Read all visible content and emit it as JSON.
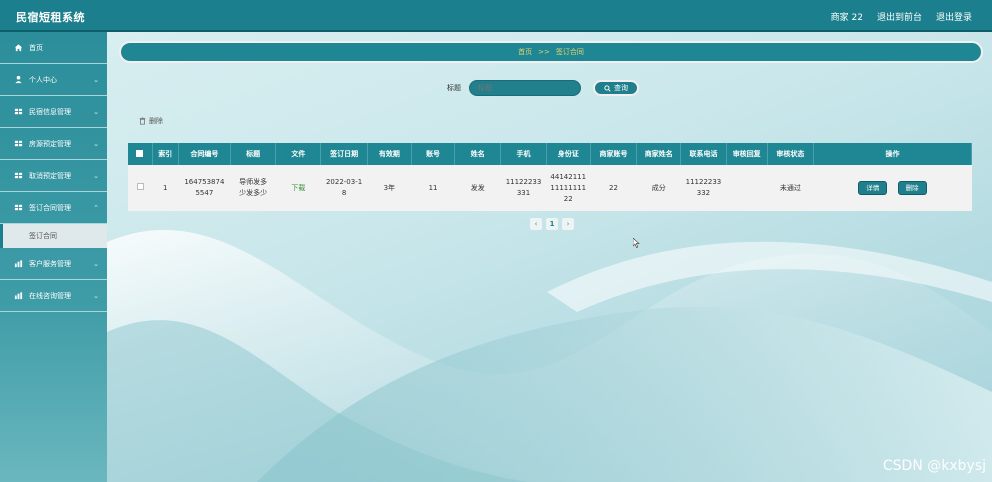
{
  "app": {
    "title": "民宿短租系统",
    "user_label": "商家 22",
    "exit_to_front": "退出到前台",
    "logout": "退出登录"
  },
  "sidebar": {
    "items": [
      {
        "label": "首页",
        "icon": "home-icon",
        "has_arrow": false
      },
      {
        "label": "个人中心",
        "icon": "user-icon",
        "has_arrow": true
      },
      {
        "label": "民宿信息管理",
        "icon": "grid-icon",
        "has_arrow": true
      },
      {
        "label": "房源预定管理",
        "icon": "grid-icon",
        "has_arrow": true
      },
      {
        "label": "取消预定管理",
        "icon": "grid-icon",
        "has_arrow": true
      },
      {
        "label": "签订合同管理",
        "icon": "grid-icon",
        "has_arrow": true
      },
      {
        "label": "客户服务管理",
        "icon": "chart-icon",
        "has_arrow": true
      },
      {
        "label": "在线咨询管理",
        "icon": "chart-icon",
        "has_arrow": true
      }
    ],
    "submenu_label": "签订合同"
  },
  "breadcrumb": {
    "home": "首页",
    "sep": ">>",
    "current": "签订合同"
  },
  "search": {
    "label": "标题",
    "placeholder": "标题",
    "button_label": "查询"
  },
  "toolbar": {
    "delete_label": "删除"
  },
  "table": {
    "headers": [
      "",
      "索引",
      "合同编号",
      "标题",
      "文件",
      "签订日期",
      "有效期",
      "账号",
      "姓名",
      "手机",
      "身份证",
      "商家账号",
      "商家姓名",
      "联系电话",
      "审核回复",
      "审核状态",
      "操作"
    ],
    "rows": [
      {
        "index": "1",
        "contract_no": "1647538745547",
        "title": "导师发多少发多少",
        "file": "下载",
        "date": "2022-03-18",
        "validity": "3年",
        "account": "11",
        "name": "发发",
        "phone": "11122233331",
        "id_card": "441421111111111122",
        "merchant_account": "22",
        "merchant_name": "成分",
        "contact_phone": "11122233332",
        "review_reply": "",
        "review_status": "未通过",
        "detail_label": "详情",
        "delete_label": "删除"
      }
    ]
  },
  "pager": {
    "prev": "‹",
    "page": "1",
    "next": "›"
  },
  "watermark": "CSDN @kxbysj",
  "colors": {
    "primary": "#1f8794",
    "topbar": "#1b7f8d",
    "breadcrumb_text": "#e7d26a"
  }
}
